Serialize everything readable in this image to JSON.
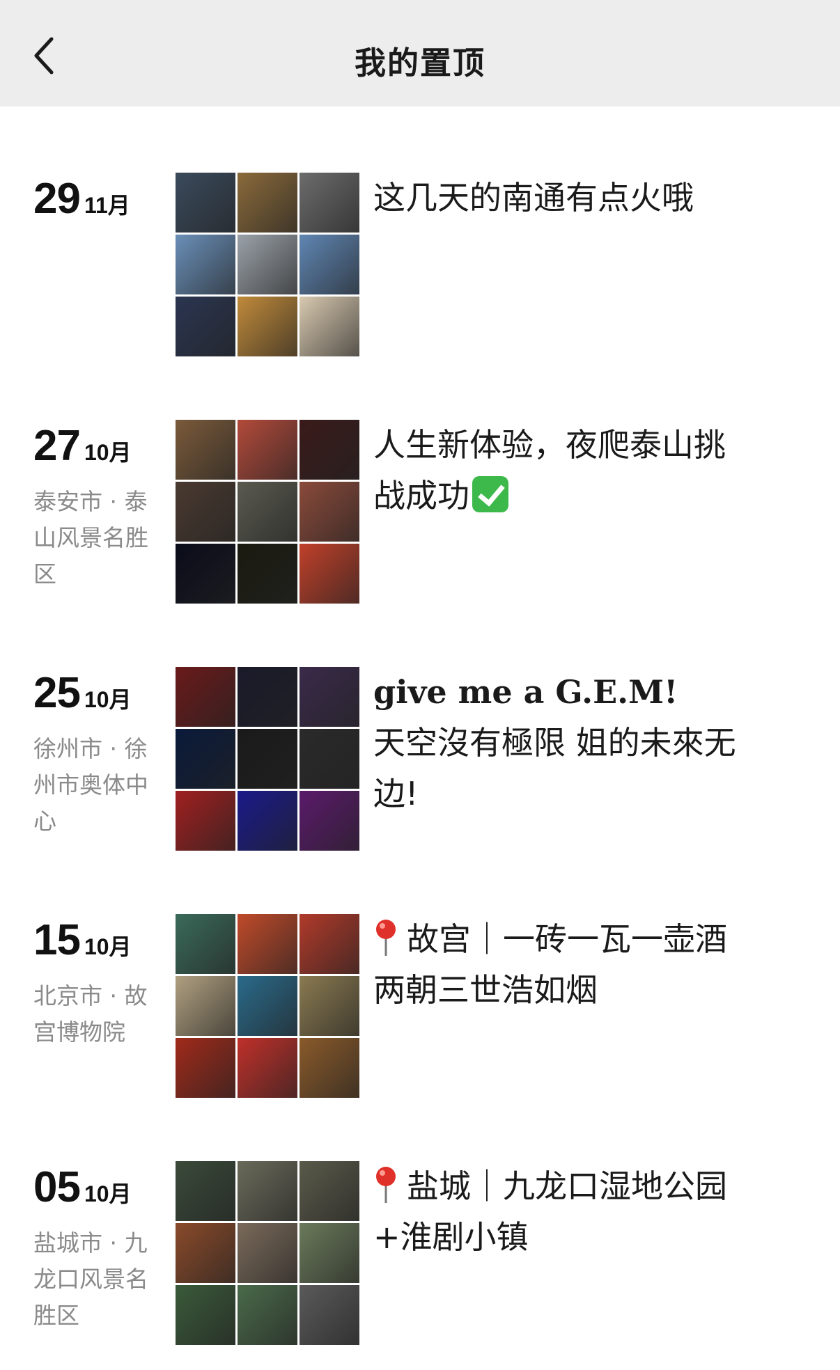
{
  "header": {
    "title": "我的置顶"
  },
  "posts": [
    {
      "day": "29",
      "month": "11月",
      "location": "",
      "caption": "这几天的南通有点火哦",
      "tiles": [
        "#3a4a5c",
        "#8a6a3a",
        "#6c6c6c",
        "#6a8fb8",
        "#9aa1a8",
        "#5f86b3",
        "#2a3550",
        "#c08a3a",
        "#d8c9b0"
      ]
    },
    {
      "day": "27",
      "month": "10月",
      "location": "泰安市 · 泰山风景名胜区",
      "caption_line1": "人生新体验，夜爬泰山挑",
      "caption_line2": "战成功",
      "tiles": [
        "#7a5a3a",
        "#b24a3a",
        "#3a1a1a",
        "#4a3a30",
        "#5a5a50",
        "#8a4a3a",
        "#0a0c1a",
        "#1a1a10",
        "#c0402a"
      ]
    },
    {
      "day": "25",
      "month": "10月",
      "location": "徐州市 · 徐州市奥体中心",
      "caption_title": "give me a G.E.M!",
      "caption_body": "天空沒有極限 姐的未來无边!",
      "tiles": [
        "#6a1a1a",
        "#1a1a2a",
        "#3a2a4a",
        "#0a1a3a",
        "#1a1a1a",
        "#2a2a2a",
        "#a02020",
        "#1a1a8a",
        "#5a1a6a"
      ]
    },
    {
      "day": "15",
      "month": "10月",
      "location": "北京市 · 故宫博物院",
      "caption_pin_text": "故宫｜一砖一瓦一壶酒",
      "caption_line2": "两朝三世浩如烟",
      "tiles": [
        "#3a6a5a",
        "#c04a2a",
        "#b03a2a",
        "#b0a080",
        "#2a6a8a",
        "#8a7a50",
        "#a02a1a",
        "#c0302a",
        "#8a5a2a"
      ]
    },
    {
      "day": "05",
      "month": "10月",
      "location": "盐城市 · 九龙口风景名胜区",
      "caption_pin_text": "盐城｜九龙口湿地公园",
      "caption_line2": "+淮剧小镇",
      "tiles": [
        "#3a4a3a",
        "#6a6a5a",
        "#5a5a4a",
        "#8a4a2a",
        "#7a6a5a",
        "#6a7a5a",
        "#3a5a3a",
        "#4a6a4a",
        "#5a5a5a"
      ]
    }
  ]
}
